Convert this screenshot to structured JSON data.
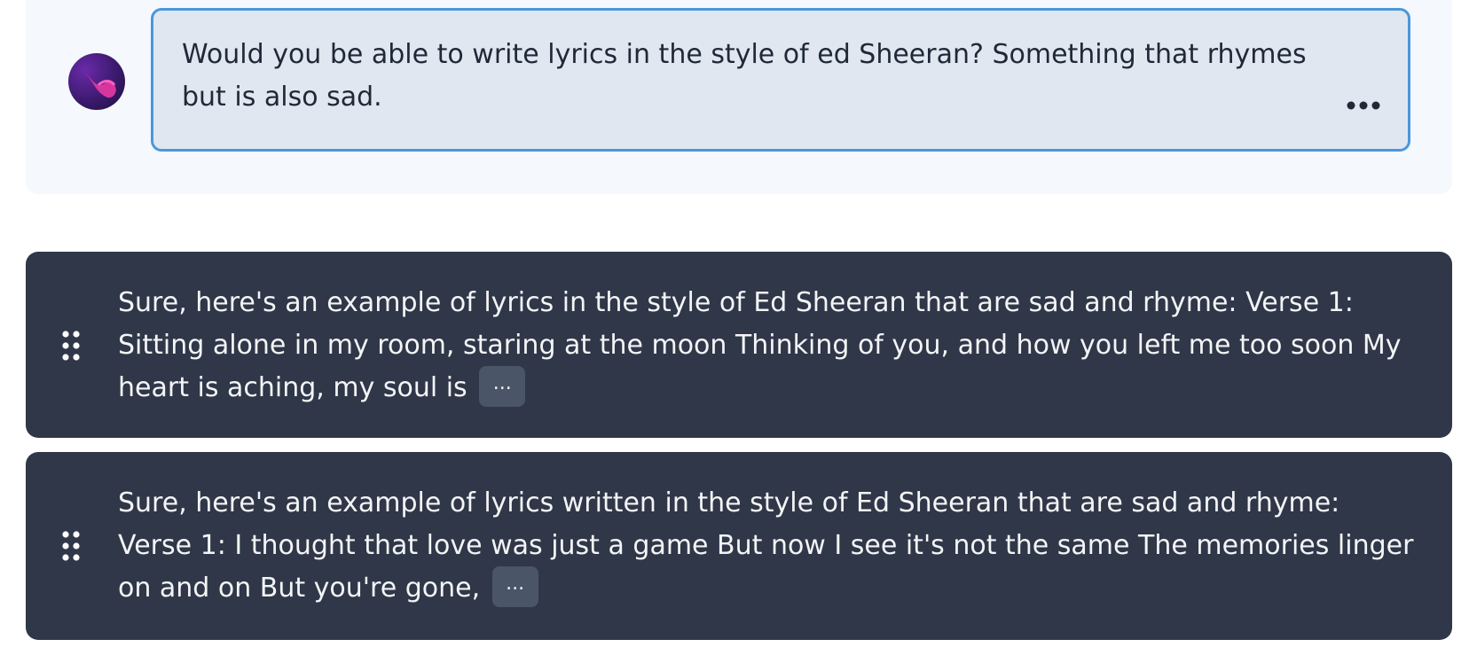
{
  "prompt": {
    "text": "Would you be able to write lyrics in the style of ed Sheeran? Something that rhymes but is also sad.",
    "more_icon": "ellipsis-horizontal-icon"
  },
  "replies": [
    {
      "text": "Sure, here's an example of lyrics in the style of Ed Sheeran that are sad and rhyme: Verse 1: Sitting alone in my room, staring at the moon Thinking of you, and how you left me too soon My heart is aching, my soul is",
      "expand_label": "...",
      "handle_icon": "drag-handle-icon"
    },
    {
      "text": "Sure, here's an example of lyrics written in the style of Ed Sheeran that are sad and rhyme: Verse 1: I thought that love was just a game But now I see it's not the same The memories linger on and on But you're gone,",
      "expand_label": "...",
      "handle_icon": "drag-handle-icon"
    }
  ],
  "colors": {
    "prompt_border": "#4a98db",
    "prompt_bg": "#e0e7f1",
    "reply_bg": "#2f3748",
    "expand_bg": "#4b5568"
  }
}
